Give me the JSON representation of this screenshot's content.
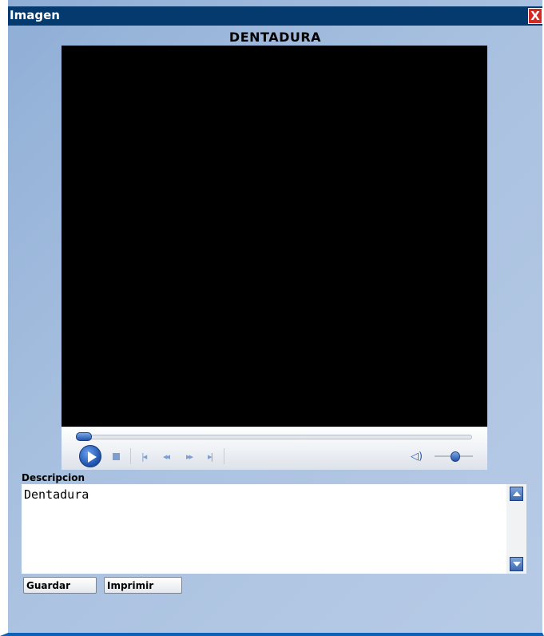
{
  "window": {
    "title": "Imagen",
    "close_label": "X"
  },
  "media": {
    "title": "DENTADURA",
    "player": {
      "seek_progress": 0.02,
      "volume_level": 0.5,
      "controls": {
        "play": "play-icon",
        "stop": "stop-icon",
        "previous": "|◂",
        "rewind": "◂◂",
        "fast_forward": "▸▸",
        "next": "▸|",
        "volume": "speaker-icon"
      }
    }
  },
  "description": {
    "label": "Descripcion",
    "value": "Dentadura"
  },
  "buttons": {
    "save": "Guardar",
    "print": "Imprimir"
  },
  "colors": {
    "titlebar": "#053a6e",
    "close": "#d42a22",
    "accent": "#2453a8",
    "bottom_border": "#0d62b8"
  }
}
